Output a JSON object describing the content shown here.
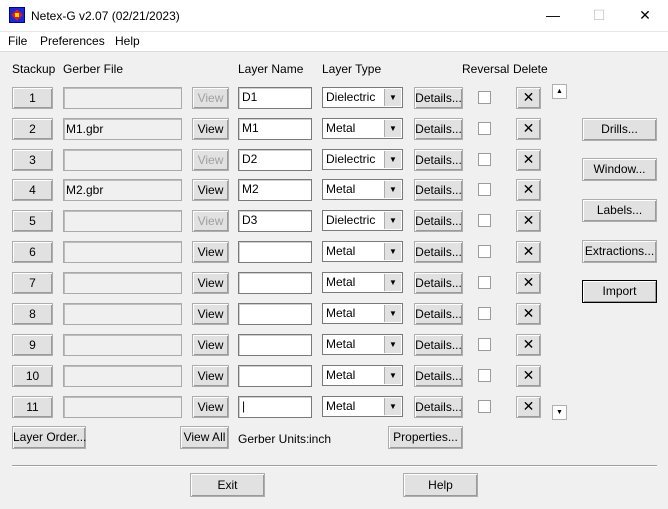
{
  "window": {
    "title": "Netex-G v2.07 (02/21/2023)",
    "minimize_glyph": "—",
    "maximize_glyph": "☐",
    "close_glyph": "✕"
  },
  "menu": {
    "file": "File",
    "preferences": "Preferences",
    "help": "Help"
  },
  "headers": {
    "stackup": "Stackup",
    "gerber_file": "Gerber File",
    "layer_name": "Layer Name",
    "layer_type": "Layer Type",
    "reversal": "Reversal",
    "delete": "Delete"
  },
  "row_buttons": {
    "view": "View",
    "details": "Details...",
    "delete_glyph": "✕"
  },
  "rows": [
    {
      "stackup": "1",
      "gerber": "",
      "view_enabled": false,
      "name": "D1",
      "type": "Dielectric",
      "reversal": false
    },
    {
      "stackup": "2",
      "gerber": "M1.gbr",
      "view_enabled": true,
      "name": "M1",
      "type": "Metal",
      "reversal": false
    },
    {
      "stackup": "3",
      "gerber": "",
      "view_enabled": false,
      "name": "D2",
      "type": "Dielectric",
      "reversal": false
    },
    {
      "stackup": "4",
      "gerber": "M2.gbr",
      "view_enabled": true,
      "name": "M2",
      "type": "Metal",
      "reversal": false
    },
    {
      "stackup": "5",
      "gerber": "",
      "view_enabled": false,
      "name": "D3",
      "type": "Dielectric",
      "reversal": false
    },
    {
      "stackup": "6",
      "gerber": "",
      "view_enabled": true,
      "name": "",
      "type": "Metal",
      "reversal": false
    },
    {
      "stackup": "7",
      "gerber": "",
      "view_enabled": true,
      "name": "",
      "type": "Metal",
      "reversal": false
    },
    {
      "stackup": "8",
      "gerber": "",
      "view_enabled": true,
      "name": "",
      "type": "Metal",
      "reversal": false
    },
    {
      "stackup": "9",
      "gerber": "",
      "view_enabled": true,
      "name": "",
      "type": "Metal",
      "reversal": false
    },
    {
      "stackup": "10",
      "gerber": "",
      "view_enabled": true,
      "name": "",
      "type": "Metal",
      "reversal": false
    },
    {
      "stackup": "11",
      "gerber": "",
      "view_enabled": true,
      "name": "|",
      "type": "Metal",
      "reversal": false
    }
  ],
  "side_buttons": {
    "drills": "Drills...",
    "window": "Window...",
    "labels": "Labels...",
    "extractions": "Extractions...",
    "import": "Import"
  },
  "bottom": {
    "layer_order": "Layer Order...",
    "view_all": "View All",
    "gerber_units_label": "Gerber Units:",
    "gerber_units_value": "inch",
    "properties": "Properties...",
    "exit": "Exit",
    "help": "Help"
  },
  "scrollbar": {
    "up_glyph": "▲",
    "down_glyph": "▼"
  }
}
